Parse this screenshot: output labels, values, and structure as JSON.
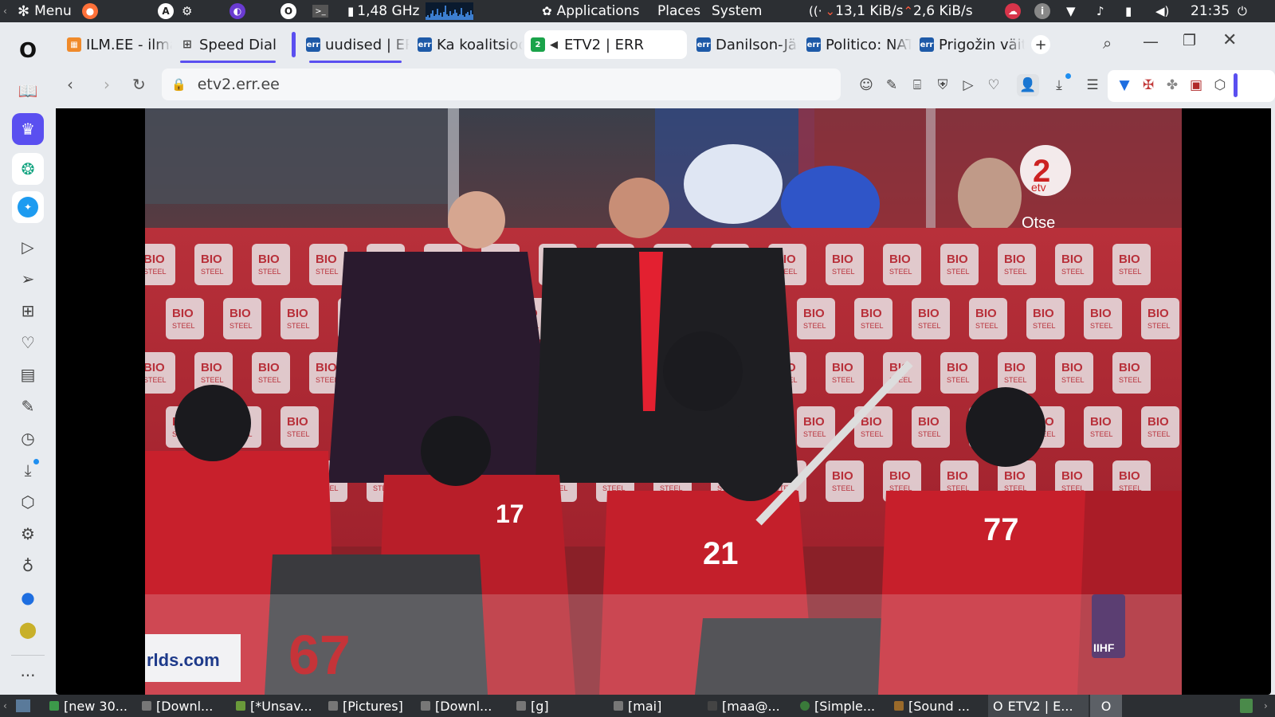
{
  "system_panel": {
    "menu_label": "Menu",
    "cpu_freq": "1,48 GHz",
    "applications": "Applications",
    "places": "Places",
    "system": "System",
    "net_down": "13,1 KiB/s",
    "net_up": "2,6 KiB/s",
    "clock": "21:35"
  },
  "tabs": [
    {
      "label": "ILM.EE - ilma",
      "favicon": "ilm-favicon"
    },
    {
      "label": "Speed Dial",
      "favicon": "speed-dial-icon"
    },
    {
      "label": "uudised | ERR",
      "favicon": "err-favicon"
    },
    {
      "label": "Ka koalitsioon",
      "favicon": "err-favicon"
    },
    {
      "label": "ETV2 | ERR",
      "favicon": "etv2-favicon",
      "active": true,
      "audio": true
    },
    {
      "label": "Danilson-Järg",
      "favicon": "err-favicon"
    },
    {
      "label": "Politico: NATO",
      "favicon": "err-favicon"
    },
    {
      "label": "Prigožin väit",
      "favicon": "err-favicon"
    }
  ],
  "address": {
    "url": "etv2.err.ee"
  },
  "video": {
    "channel_logo": "2",
    "channel_name": "etv",
    "live_label": "Otse",
    "board_text": "rlds.com",
    "corner_logo": "IIHF",
    "ad_text": "BIO",
    "ad_subtext": "STEEL",
    "jersey_numbers": [
      "77",
      "21",
      "17",
      "67"
    ]
  },
  "taskbar": {
    "tasks": [
      {
        "label": "[new 30..."
      },
      {
        "label": "[Downl..."
      },
      {
        "label": "[*Unsav..."
      },
      {
        "label": "[Pictures]"
      },
      {
        "label": "[Downl..."
      },
      {
        "label": "[g]"
      },
      {
        "label": "[mai]"
      },
      {
        "label": "[maa@..."
      },
      {
        "label": "[Simple..."
      },
      {
        "label": "[Sound ..."
      },
      {
        "label": "ETV2 | E..."
      }
    ]
  },
  "colors": {
    "accent": "#5a4ff0",
    "panel": "#2c2f33",
    "chrome": "#e8ebef",
    "err_blue": "#1e5aa8",
    "canada_red": "#d52b36"
  }
}
